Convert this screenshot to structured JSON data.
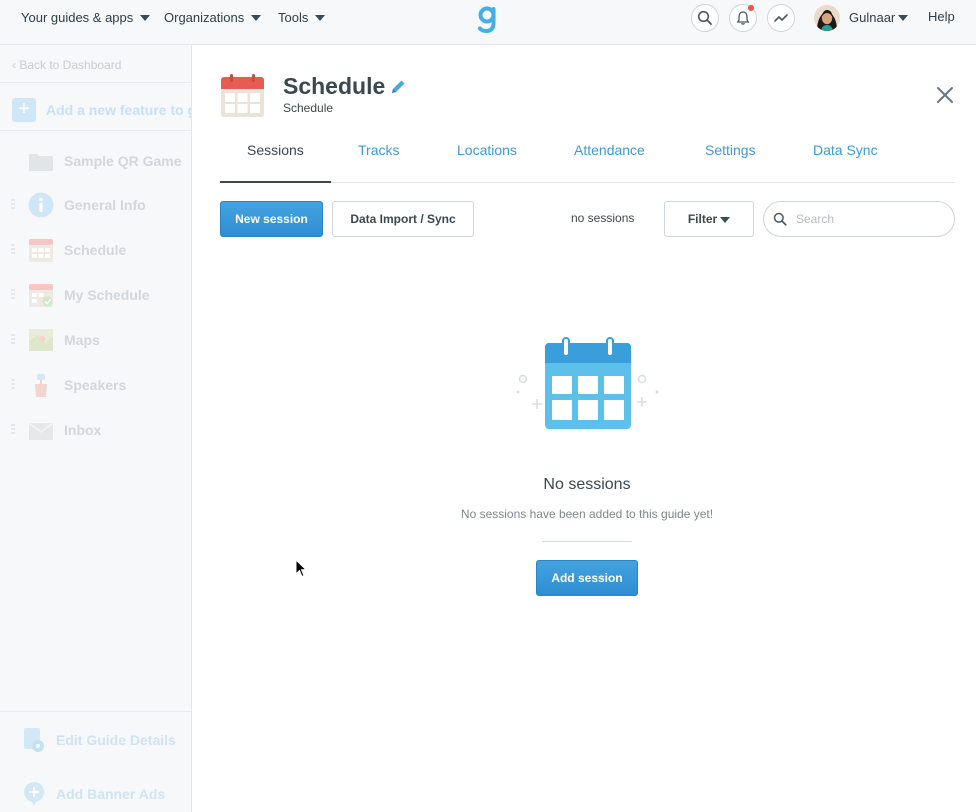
{
  "topnav": {
    "guides_menu": "Your guides & apps",
    "organizations_menu": "Organizations",
    "tools_menu": "Tools",
    "user_name": "Gulnaar",
    "help": "Help"
  },
  "sidebar": {
    "back_link": "‹ Back to Dashboard",
    "add_feature": "Add a new feature to guide",
    "items": [
      {
        "label": "Sample QR Game",
        "icon": "folder-icon"
      },
      {
        "label": "General Info",
        "icon": "info-icon"
      },
      {
        "label": "Schedule",
        "icon": "calendar-icon"
      },
      {
        "label": "My Schedule",
        "icon": "calendar-check-icon"
      },
      {
        "label": "Maps",
        "icon": "map-icon"
      },
      {
        "label": "Speakers",
        "icon": "speaker-icon"
      },
      {
        "label": "Inbox",
        "icon": "inbox-icon"
      }
    ],
    "edit_guide": "Edit Guide Details",
    "add_banner": "Add Banner Ads"
  },
  "panel": {
    "title": "Schedule",
    "subtitle": "Schedule",
    "tabs": [
      {
        "label": "Sessions",
        "active": true
      },
      {
        "label": "Tracks",
        "active": false
      },
      {
        "label": "Locations",
        "active": false
      },
      {
        "label": "Attendance",
        "active": false
      },
      {
        "label": "Settings",
        "active": false
      },
      {
        "label": "Data Sync",
        "active": false
      }
    ],
    "new_session": "New session",
    "data_import": "Data Import / Sync",
    "session_count": "no sessions",
    "filter": "Filter",
    "search_placeholder": "Search",
    "empty_title": "No sessions",
    "empty_text": "No sessions have been added to this guide yet!",
    "add_session": "Add session"
  },
  "colors": {
    "accent": "#3d9ad8",
    "calendar_header": "#e65b52",
    "illustration": "#5cc0ea",
    "notification": "#e8553e"
  }
}
